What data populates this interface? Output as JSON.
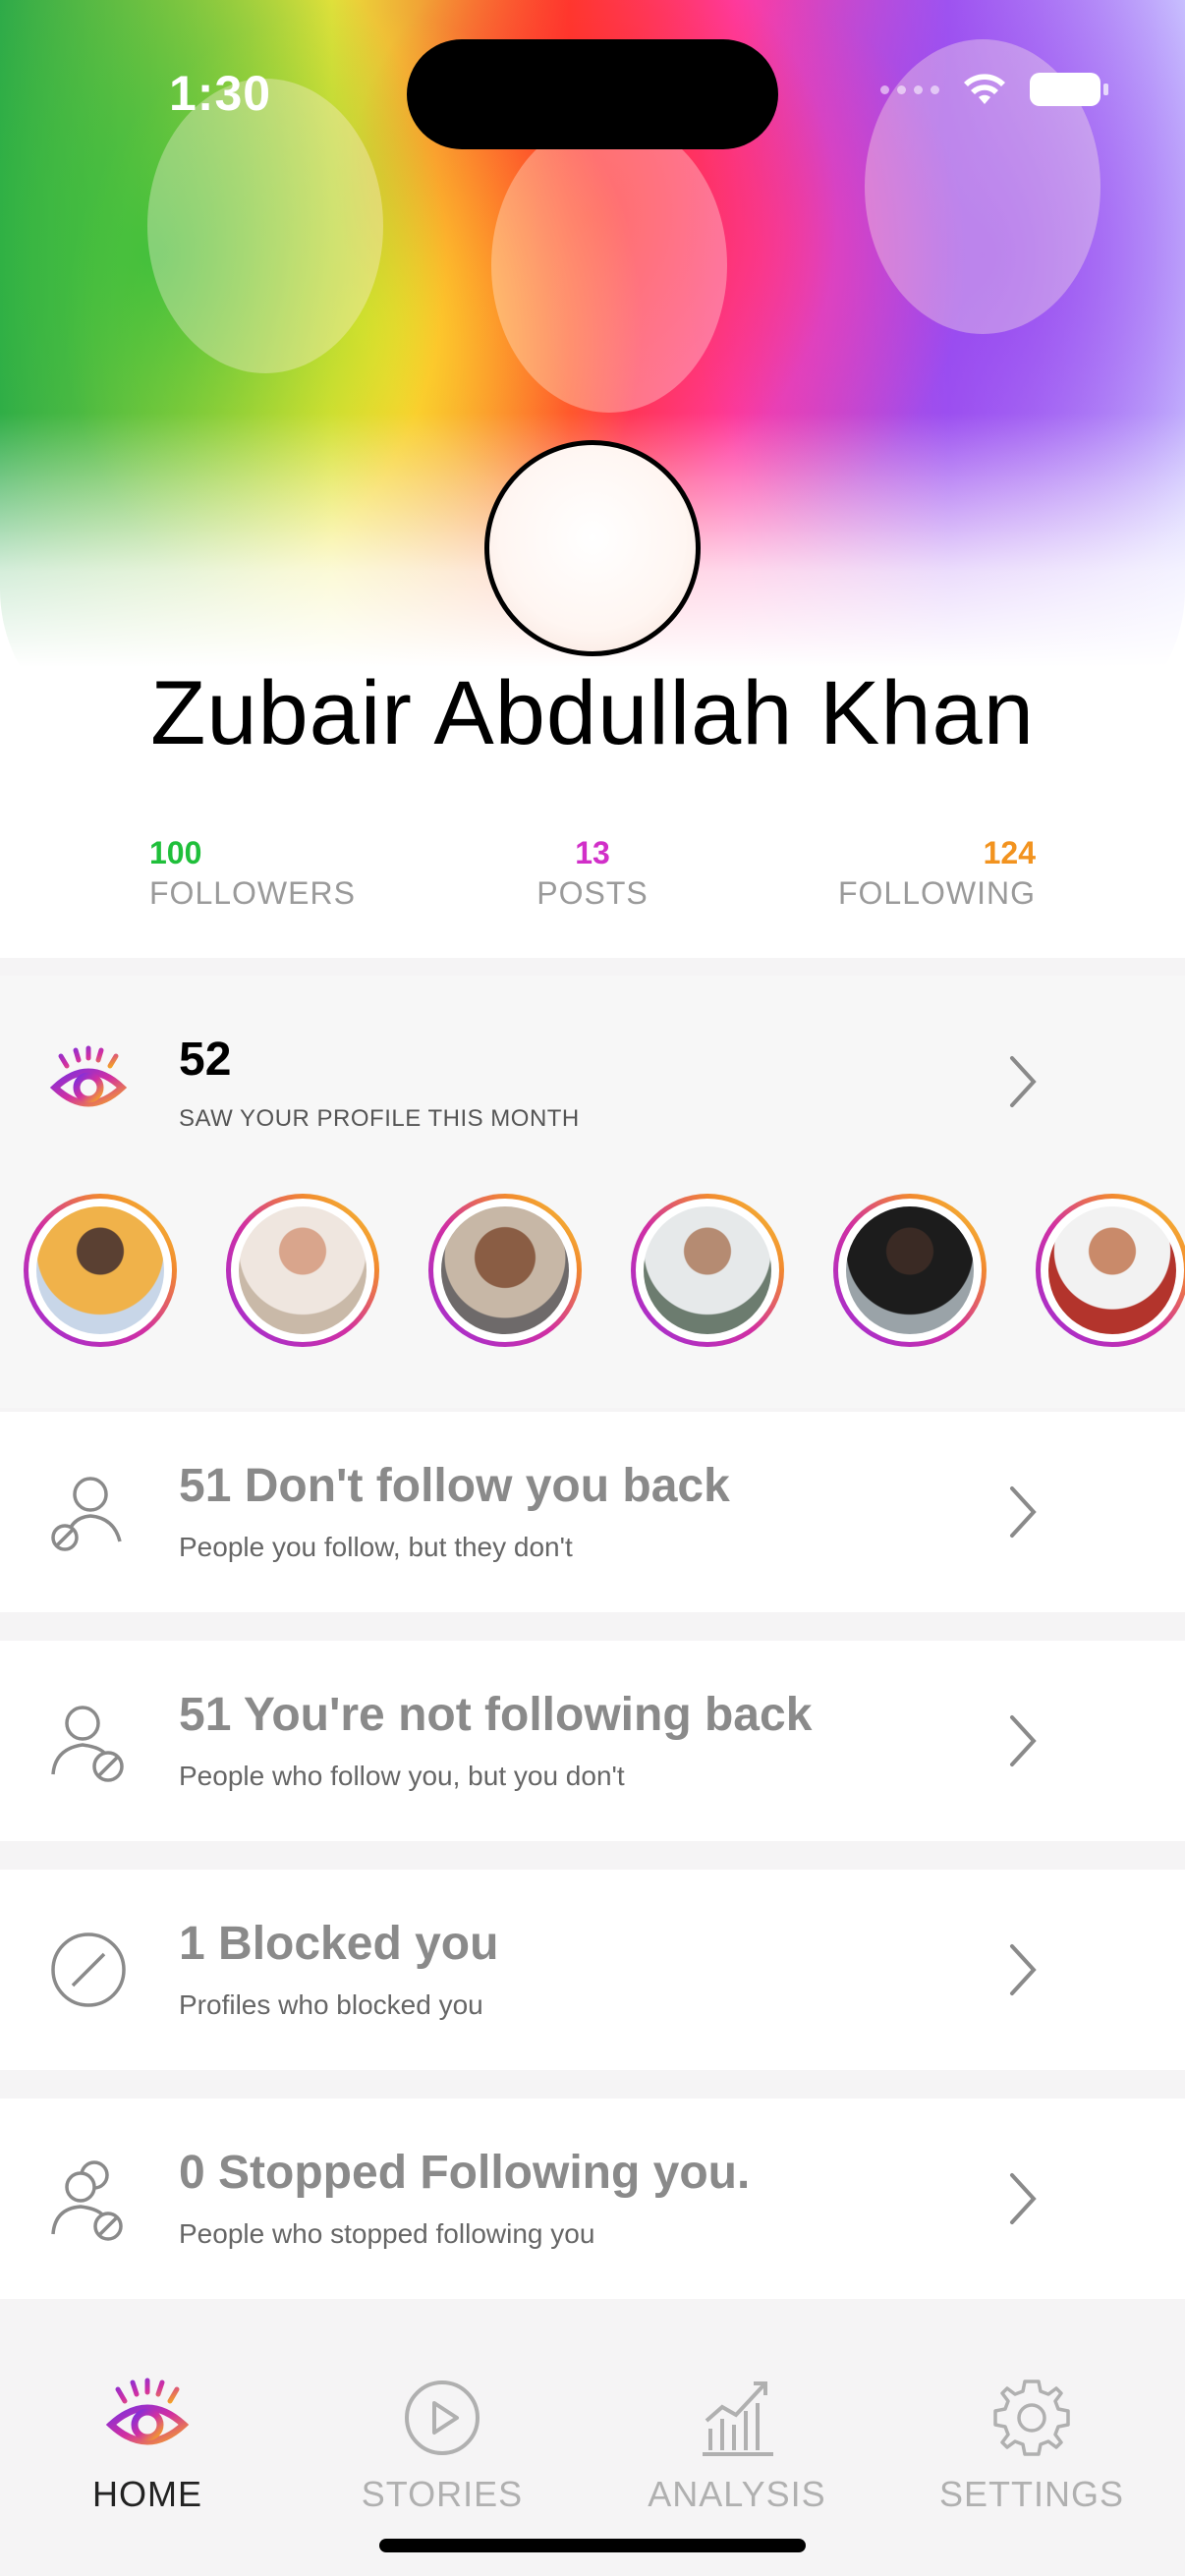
{
  "status_bar": {
    "time": "1:30"
  },
  "profile": {
    "name": "Zubair Abdullah Khan"
  },
  "stats": {
    "followers": {
      "value": "100",
      "label": "FOLLOWERS",
      "color": "#1fbf3a"
    },
    "posts": {
      "value": "13",
      "label": "POSTS",
      "color": "#d12fc8"
    },
    "following": {
      "value": "124",
      "label": "FOLLOWING",
      "color": "#f2931f"
    }
  },
  "visitors": {
    "count": "52",
    "subtitle": "SAW YOUR PROFILE THIS MONTH",
    "avatars": [
      "visitor-1",
      "visitor-2",
      "visitor-3",
      "visitor-4",
      "visitor-5",
      "visitor-6"
    ]
  },
  "list": [
    {
      "icon": "user-remove-icon",
      "title": "51 Don't follow you back",
      "subtitle": "People you follow, but they don't"
    },
    {
      "icon": "user-block-icon",
      "title": "51 You're not following back",
      "subtitle": "People who follow you, but you don't"
    },
    {
      "icon": "blocked-icon",
      "title": "1 Blocked you",
      "subtitle": "Profiles who blocked you"
    },
    {
      "icon": "users-stopped-icon",
      "title": "0 Stopped Following you.",
      "subtitle": "People who stopped following you"
    }
  ],
  "tabs": [
    {
      "icon": "eye-icon",
      "label": "HOME",
      "active": true
    },
    {
      "icon": "play-icon",
      "label": "STORIES",
      "active": false
    },
    {
      "icon": "chart-icon",
      "label": "ANALYSIS",
      "active": false
    },
    {
      "icon": "gear-icon",
      "label": "SETTINGS",
      "active": false
    }
  ],
  "colors": {
    "accent_purple": "#9b2fd8",
    "accent_pink": "#d12fa2",
    "accent_orange": "#f28a2e"
  }
}
